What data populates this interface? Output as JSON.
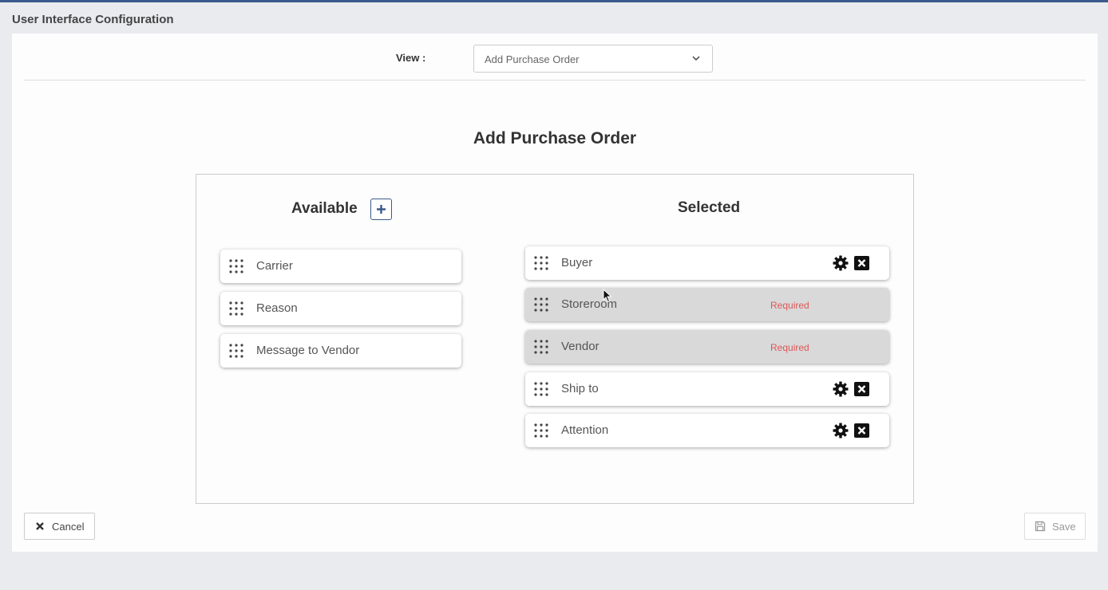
{
  "page": {
    "title": "User Interface Configuration"
  },
  "view": {
    "label": "View :",
    "selected": "Add Purchase Order"
  },
  "form": {
    "title": "Add Purchase Order"
  },
  "available": {
    "title": "Available",
    "items": [
      {
        "label": "Carrier"
      },
      {
        "label": "Reason"
      },
      {
        "label": "Message to Vendor"
      }
    ]
  },
  "selected": {
    "title": "Selected",
    "items": [
      {
        "label": "Buyer",
        "required": false
      },
      {
        "label": "Storeroom",
        "required": true,
        "required_text": "Required"
      },
      {
        "label": "Vendor",
        "required": true,
        "required_text": "Required"
      },
      {
        "label": "Ship to",
        "required": false
      },
      {
        "label": "Attention",
        "required": false
      }
    ]
  },
  "buttons": {
    "cancel": "Cancel",
    "save": "Save"
  },
  "colors": {
    "accent": "#3a5a8c",
    "required": "#e05555",
    "required_bg": "#d9d9d9"
  }
}
